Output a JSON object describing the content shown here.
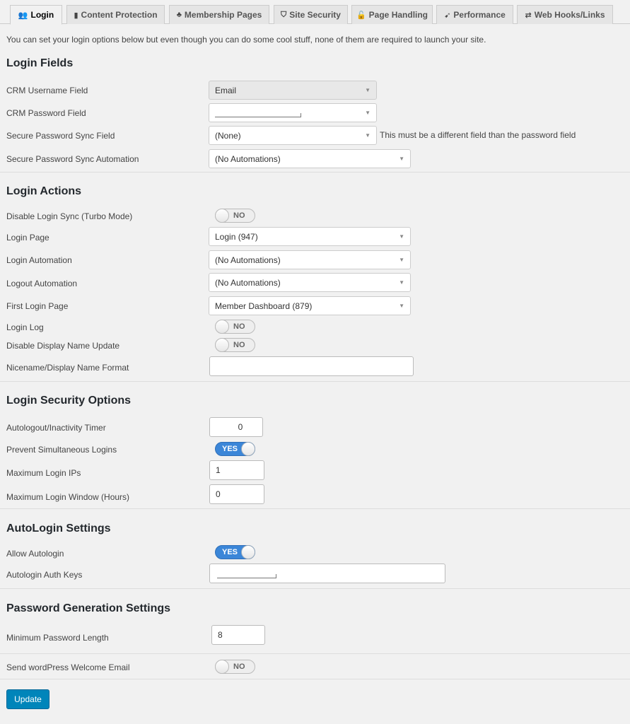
{
  "tabs": [
    {
      "label": "Login",
      "icon": "users-icon",
      "glyph": "👥",
      "active": true
    },
    {
      "label": "Content Protection",
      "icon": "file-icon",
      "glyph": "▮",
      "active": false
    },
    {
      "label": "Membership Pages",
      "icon": "sitemap-icon",
      "glyph": "♣",
      "active": false
    },
    {
      "label": "Site Security",
      "icon": "shield-icon",
      "glyph": "⛉",
      "active": false
    },
    {
      "label": "Page Handling",
      "icon": "unlock-icon",
      "glyph": "🔓",
      "active": false
    },
    {
      "label": "Performance",
      "icon": "rocket-icon",
      "glyph": "➹",
      "active": false
    },
    {
      "label": "Web Hooks/Links",
      "icon": "exchange-icon",
      "glyph": "⇄",
      "active": false
    }
  ],
  "intro": "You can set your login options below but even though you can do some cool stuff, none of them are required to launch your site.",
  "sections": {
    "login_fields": {
      "title": "Login Fields",
      "crm_username": {
        "label": "CRM Username Field",
        "value": "Email"
      },
      "crm_password": {
        "label": "CRM Password Field",
        "value": ""
      },
      "secure_sync_field": {
        "label": "Secure Password Sync Field",
        "value": "(None)",
        "hint": "This must be a different field than the password field"
      },
      "secure_sync_automation": {
        "label": "Secure Password Sync Automation",
        "value": "(No Automations)"
      }
    },
    "login_actions": {
      "title": "Login Actions",
      "disable_login_sync": {
        "label": "Disable Login Sync (Turbo Mode)",
        "state": "NO"
      },
      "login_page": {
        "label": "Login Page",
        "value": "Login (947)"
      },
      "login_automation": {
        "label": "Login Automation",
        "value": "(No Automations)"
      },
      "logout_automation": {
        "label": "Logout Automation",
        "value": "(No Automations)"
      },
      "first_login_page": {
        "label": "First Login Page",
        "value": "Member Dashboard (879)"
      },
      "login_log": {
        "label": "Login Log",
        "state": "NO"
      },
      "disable_display_name": {
        "label": "Disable Display Name Update",
        "state": "NO"
      },
      "nicename_format": {
        "label": "Nicename/Display Name Format",
        "value": ""
      }
    },
    "login_security": {
      "title": "Login Security Options",
      "autologout": {
        "label": "Autologout/Inactivity Timer",
        "value": "0"
      },
      "prevent_simultaneous": {
        "label": "Prevent Simultaneous Logins",
        "state": "YES"
      },
      "max_ips": {
        "label": "Maximum Login IPs",
        "value": "1"
      },
      "max_window": {
        "label": "Maximum Login Window (Hours)",
        "value": "0"
      }
    },
    "autologin": {
      "title": "AutoLogin Settings",
      "allow": {
        "label": "Allow Autologin",
        "state": "YES"
      },
      "auth_keys": {
        "label": "Autologin Auth Keys",
        "value": ""
      }
    },
    "password_generation": {
      "title": "Password Generation Settings",
      "min_length": {
        "label": "Minimum Password Length",
        "value": "8"
      }
    },
    "welcome_email": {
      "label": "Send wordPress Welcome Email",
      "state": "NO"
    }
  },
  "update_button": "Update",
  "colors": {
    "toggle_on": "#3b86d8",
    "primary_button": "#0085ba"
  }
}
